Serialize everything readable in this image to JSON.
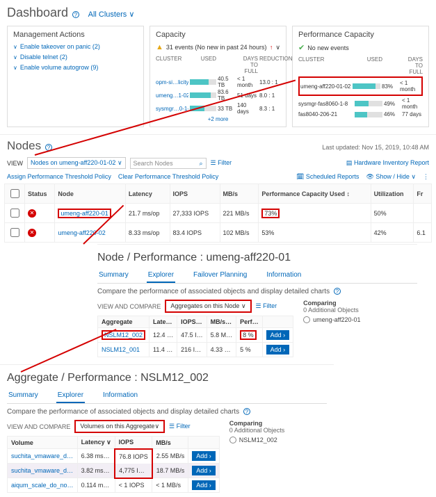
{
  "dashboard": {
    "title": "Dashboard",
    "scope": "All Clusters",
    "management": {
      "title": "Management Actions",
      "items": [
        {
          "label": "Enable takeover on panic (2)"
        },
        {
          "label": "Disable telnet (2)"
        },
        {
          "label": "Enable volume autogrow (9)"
        }
      ]
    },
    "capacity": {
      "title": "Capacity",
      "events": "31 events (No new in past 24 hours)",
      "cols": {
        "c1": "CLUSTER",
        "c2": "USED",
        "c3": "",
        "c4": "DAYS TO FULL",
        "c5": "REDUCTION"
      },
      "rows": [
        {
          "name": "opm-si…licity",
          "used_label": "40.5 TB",
          "fill": 70,
          "days": "< 1 month",
          "red": "13.0 : 1"
        },
        {
          "name": "umeng…1-02",
          "used_label": "83.6 TB",
          "fill": 80,
          "days": "51 days",
          "red": "8.0 : 1"
        },
        {
          "name": "sysmgr…0-1-8",
          "used_label": "33 TB",
          "fill": 55,
          "days": "140 days",
          "red": "8.3 : 1"
        }
      ],
      "more": "+2 more"
    },
    "perfcap": {
      "title": "Performance Capacity",
      "events": "No new events",
      "cols": {
        "c1": "CLUSTER",
        "c2": "USED",
        "c3": "",
        "c4": "DAYS TO FULL"
      },
      "rows": [
        {
          "name": "umeng-aff220-01-02",
          "fill": 83,
          "pct": "83%",
          "days": "< 1 month",
          "hl": true
        },
        {
          "name": "sysmgr-fas8060-1-8",
          "fill": 49,
          "pct": "49%",
          "days": "< 1 month"
        },
        {
          "name": "fas8040-206-21",
          "fill": 46,
          "pct": "46%",
          "days": "77 days"
        }
      ]
    }
  },
  "nodes": {
    "title": "Nodes",
    "updated": "Last updated: Nov 15, 2019, 10:48 AM",
    "view_label": "VIEW",
    "view_value": "Nodes on umeng-aff220-01-02",
    "search": "Search Nodes",
    "filter": "Filter",
    "hw_report": "Hardware Inventory Report",
    "actions": {
      "assign": "Assign Performance Threshold Policy",
      "clear": "Clear Performance Threshold Policy",
      "sched": "Scheduled Reports",
      "show": "Show / Hide"
    },
    "cols": {
      "status": "Status",
      "node": "Node",
      "latency": "Latency",
      "iops": "IOPS",
      "mbs": "MB/s",
      "pcu": "Performance Capacity Used",
      "util": "Utilization",
      "fr": "Fr"
    },
    "rows": [
      {
        "node": "umeng-aff220-01",
        "lat": "21.7 ms/op",
        "iops": "27,333 IOPS",
        "mbs": "221 MB/s",
        "pcu": "73%",
        "util": "50%",
        "hl": true
      },
      {
        "node": "umeng-aff220-02",
        "lat": "8.33 ms/op",
        "iops": "83.4 IOPS",
        "mbs": "102 MB/s",
        "pcu": "53%",
        "util": "42%",
        "fr": "6.1"
      }
    ]
  },
  "node_perf": {
    "title": "Node / Performance : umeng-aff220-01",
    "tabs": {
      "summary": "Summary",
      "explorer": "Explorer",
      "failover": "Failover Planning",
      "info": "Information"
    },
    "compare_txt": "Compare the performance of associated objects and display detailed charts",
    "vc_label": "VIEW AND COMPARE",
    "vc_value": "Aggregates on this Node",
    "filter": "Filter",
    "cols": {
      "agg": "Aggregate",
      "lat": "Late…",
      "iops": "IOPS…",
      "mbs": "MB/s…",
      "perf": "Perf…"
    },
    "rows": [
      {
        "agg": "NSLM12_002",
        "lat": "12.4 …",
        "iops": "47.5 I…",
        "mbs": "5.8 M…",
        "perf": "8 %",
        "hl": true
      },
      {
        "agg": "NSLM12_001",
        "lat": "11.4 …",
        "iops": "216 I…",
        "mbs": "4.33 …",
        "perf": "5 %"
      }
    ],
    "add": "Add ›",
    "comparing": {
      "title": "Comparing",
      "sub": "0 Additional Objects",
      "item": "umeng-aff220-01"
    }
  },
  "agg_perf": {
    "title": "Aggregate / Performance : NSLM12_002",
    "tabs": {
      "summary": "Summary",
      "explorer": "Explorer",
      "info": "Information"
    },
    "compare_txt": "Compare the performance of associated objects and display detailed charts",
    "vc_label": "VIEW AND COMPARE",
    "vc_value": "Volumes on this Aggregate",
    "filter": "Filter",
    "cols": {
      "vol": "Volume",
      "lat": "Latency",
      "iops": "IOPS",
      "mbs": "MB/s"
    },
    "rows": [
      {
        "vol": "suchita_vmaware_d…",
        "lat": "6.38 ms…",
        "iops": "76.8 IOPS",
        "mbs": "2.55 MB/s"
      },
      {
        "vol": "suchita_vmaware_d…",
        "lat": "3.82 ms…",
        "iops": "4,775 I…",
        "mbs": "18.7 MB/s"
      },
      {
        "vol": "aiqum_scale_do_no…",
        "lat": "0.114 m…",
        "iops": "< 1 IOPS",
        "mbs": "< 1 MB/s"
      }
    ],
    "add": "Add ›",
    "comparing": {
      "title": "Comparing",
      "sub": "0 Additional Objects",
      "item": "NSLM12_002"
    }
  }
}
